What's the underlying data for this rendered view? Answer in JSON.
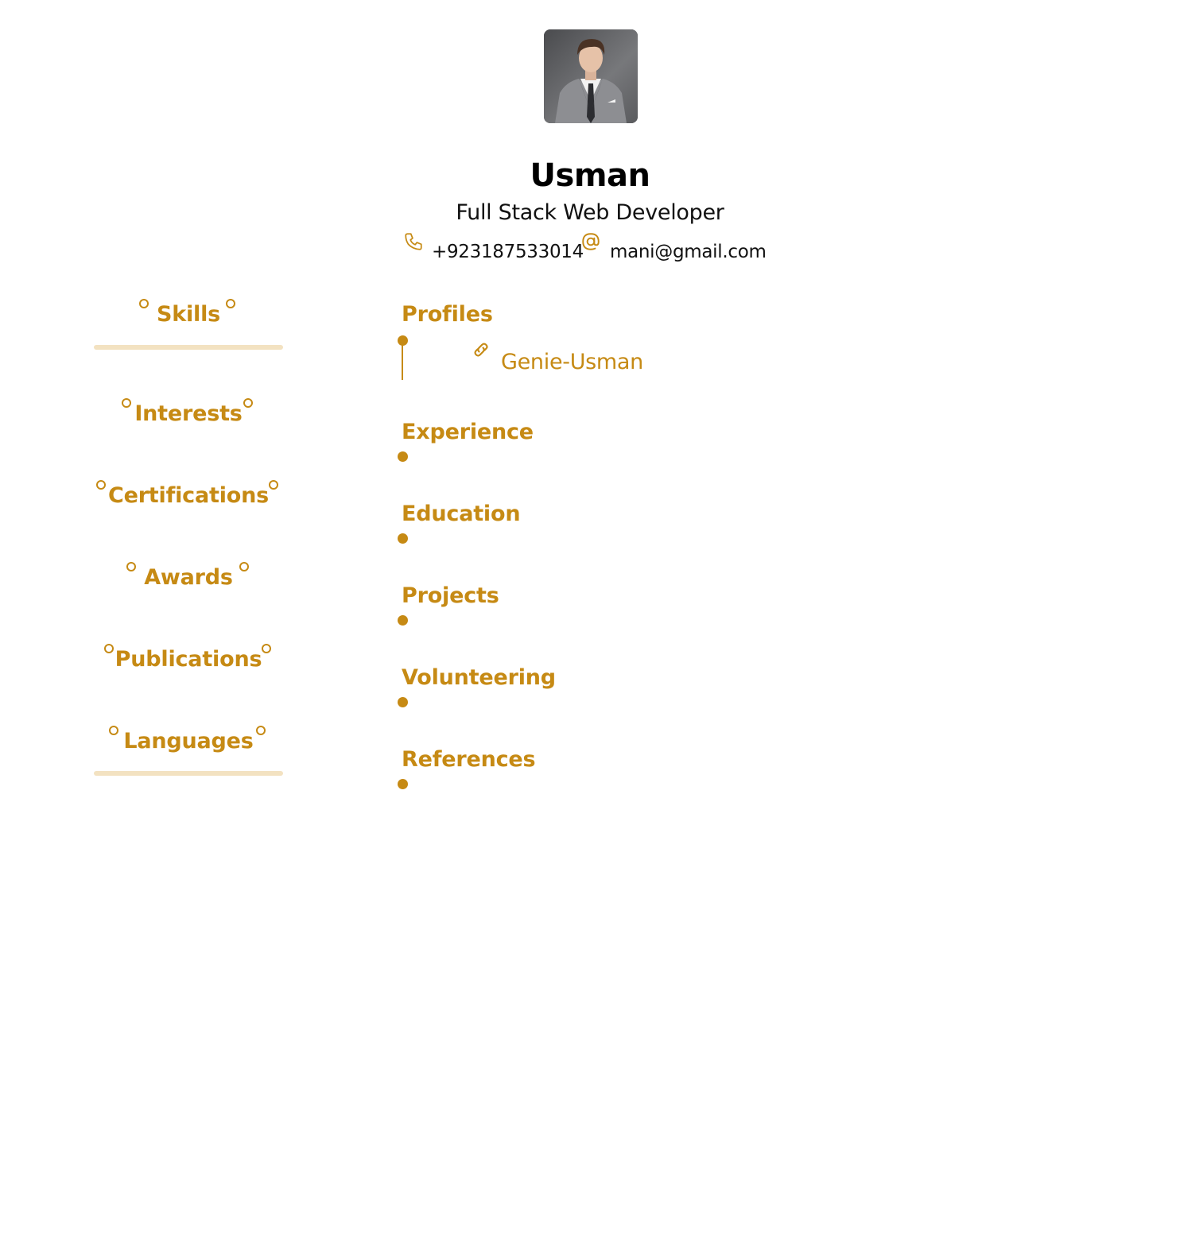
{
  "header": {
    "photo_alt": "Profile photo",
    "name": "Usman",
    "headline": "Full Stack Web Developer",
    "phone": "+923187533014",
    "email": "mani@gmail.com",
    "phone_icon": "phone-icon",
    "email_icon": "at-icon"
  },
  "left_sections": [
    {
      "label": "Skills"
    },
    {
      "label": "Interests"
    },
    {
      "label": "Certifications"
    },
    {
      "label": "Awards"
    },
    {
      "label": "Publications"
    },
    {
      "label": "Languages"
    }
  ],
  "right_sections": [
    {
      "label": "Profiles"
    },
    {
      "label": "Experience"
    },
    {
      "label": "Education"
    },
    {
      "label": "Projects"
    },
    {
      "label": "Volunteering"
    },
    {
      "label": "References"
    }
  ],
  "profiles": [
    {
      "username": "Genie-Usman",
      "icon": "link-icon"
    }
  ],
  "colors": {
    "accent": "#c68a14",
    "divider": "#f3e2c1",
    "text": "#111111"
  }
}
